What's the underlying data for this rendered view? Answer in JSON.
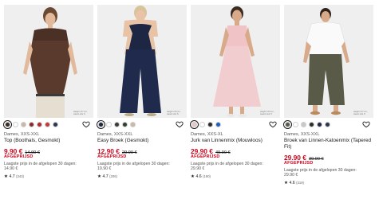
{
  "products": [
    {
      "image_caption": "Height 177 cm, wears size S",
      "swatch_colors": [
        "#3b2b22",
        "#ffffff",
        "#c9b9a6",
        "#8a2a2a",
        "#b22a2e",
        "#c23a3a",
        "#2b3550"
      ],
      "sizes": "Dames, XXS-XXL",
      "name": "Top (Boothals, Gesmokt)",
      "price": "9.90 €",
      "old_price": "14.90 €",
      "sale_label": "AFGEPRIJSD",
      "lowest_price_text": "Laagste prijs in de afgelopen 30 dagen:",
      "lowest_price": "14.90 €",
      "rating": "4.7",
      "review_count": "(343)"
    },
    {
      "image_caption": "Height 170 cm, wears size S",
      "swatch_colors": [
        "#1d2744",
        "#ffffff",
        "#3b3b3b",
        "#2f3f2f",
        "#c9b9a6"
      ],
      "sizes": "Dames, XXS-XXL",
      "name": "Easy Broek (Gesmokt)",
      "price": "12.90 €",
      "old_price": "29.90 €",
      "sale_label": "AFGEPRIJSD",
      "lowest_price_text": "Laagste prijs in de afgelopen 30 dagen:",
      "lowest_price": "19.90 €",
      "rating": "4.7",
      "review_count": "(206)"
    },
    {
      "image_caption": "Height 170 cm, wears size S",
      "swatch_colors": [
        "#f0c4c6",
        "#ffffff",
        "#2b2b2b",
        "#1f5fbf"
      ],
      "sizes": "Dames, XXS-XL",
      "name": "Jurk van Linnenmix (Mouwloos)",
      "price": "29.90 €",
      "old_price": "49.90 €",
      "sale_label": "AFGEPRIJSD",
      "lowest_price_text": "Laagste prijs in de afgelopen 30 dagen:",
      "lowest_price": "29.90 €",
      "rating": "4.6",
      "review_count": "(190)"
    },
    {
      "image_caption": "Height 177 cm, wears size S",
      "swatch_colors": [
        "#5a5a48",
        "#ffffff",
        "#c9c9c9",
        "#2b2b2b",
        "#1d2744",
        "#2b3550"
      ],
      "sizes": "Dames, XXS-XXL",
      "name": "Broek van Linnen-Katoenmix (Tapered Fit)",
      "price": "29.90 €",
      "old_price": "39.90 €",
      "sale_label": "AFGEPRIJSD",
      "lowest_price_text": "Laagste prijs in de afgelopen 30 dagen:",
      "lowest_price": "29.90 €",
      "rating": "4.6",
      "review_count": "(319)"
    }
  ]
}
